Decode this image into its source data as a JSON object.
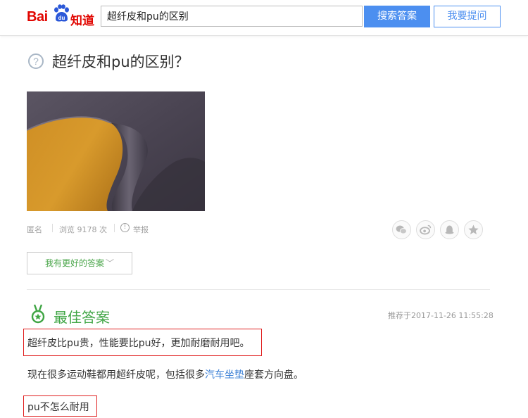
{
  "header": {
    "logo_bai": "Bai",
    "logo_du": "du",
    "logo_zhidao": "知道",
    "search_value": "超纤皮和pu的区别",
    "search_button": "搜索答案",
    "ask_button": "我要提问"
  },
  "question": {
    "icon": "question-circle-icon",
    "title": "超纤皮和pu的区别？",
    "meta": {
      "author": "匿名",
      "views": "浏览 9178 次",
      "report": "举报"
    },
    "share_icons": [
      "wechat-icon",
      "weibo-icon",
      "qq-icon",
      "star-icon"
    ],
    "better_answer_button": "我有更好的答案",
    "better_answer_chevron": "﹀"
  },
  "best_answer": {
    "title": "最佳答案",
    "recommend_time": "推荐于2017-11-26 11:55:28",
    "para1": "超纤皮比pu贵，性能要比pu好，更加耐磨耐用吧。",
    "para2_before": "现在很多运动鞋都用超纤皮呢，包括很多",
    "para2_link": "汽车坐垫",
    "para2_after": "座套方向盘。",
    "para3": "pu不怎么耐用"
  },
  "colors": {
    "brand_red": "#e10601",
    "primary_blue": "#4c8ff0",
    "success_green": "#3fa544",
    "link_blue": "#3a7fd5",
    "highlight_red": "#e02020"
  }
}
